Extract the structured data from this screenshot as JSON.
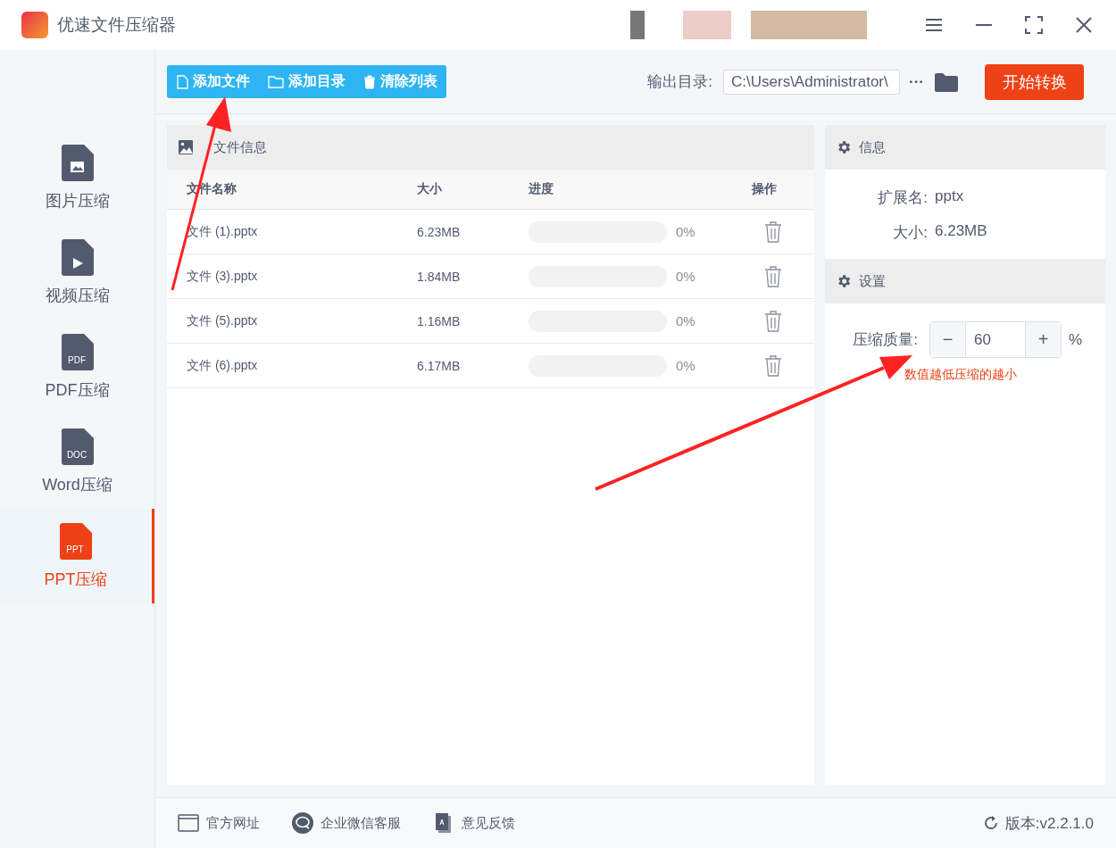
{
  "window": {
    "title": "优速文件压缩器"
  },
  "sidebar": {
    "items": [
      {
        "label": "图片压缩",
        "kind": "image",
        "selected": false
      },
      {
        "label": "视频压缩",
        "kind": "video",
        "selected": false
      },
      {
        "label": "PDF压缩",
        "kind": "text",
        "icon_text": "PDF",
        "selected": false
      },
      {
        "label": "Word压缩",
        "kind": "text",
        "icon_text": "DOC",
        "selected": false
      },
      {
        "label": "PPT压缩",
        "kind": "text",
        "icon_text": "PPT",
        "selected": true
      }
    ]
  },
  "toolbar": {
    "buttons": [
      {
        "label": "添加文件",
        "kind": "file"
      },
      {
        "label": "添加目录",
        "kind": "folder"
      },
      {
        "label": "清除列表",
        "kind": "trash"
      }
    ],
    "output_label": "输出目录:",
    "output_path": "C:\\Users\\Administrator\\",
    "more": "···",
    "start_button": "开始转换"
  },
  "file_panel": {
    "title": "文件信息",
    "columns": [
      "文件名称",
      "大小",
      "进度",
      "操作"
    ],
    "rows": [
      {
        "name": "文件 (1).pptx",
        "size": "6.23MB",
        "level": 0,
        "percent": "0%"
      },
      {
        "name": "文件 (3).pptx",
        "size": "1.84MB",
        "level": 0,
        "percent": "0%"
      },
      {
        "name": "文件 (5).pptx",
        "size": "1.16MB",
        "level": 0,
        "percent": "0%"
      },
      {
        "name": "文件 (6).pptx",
        "size": "6.17MB",
        "level": 0,
        "percent": "0%"
      }
    ]
  },
  "info_panel": {
    "title": "信息",
    "fields": [
      {
        "label": "扩展名:",
        "value": "pptx"
      },
      {
        "label": "大小:",
        "value": "6.23MB"
      }
    ]
  },
  "settings_panel": {
    "title": "设置",
    "quality_label": "压缩质量:",
    "minus": "−",
    "value": "60",
    "plus": "+",
    "unit": "%",
    "hint": "数值越低压缩的越小"
  },
  "footer": {
    "links": [
      {
        "label": "官方网址",
        "kind": "web"
      },
      {
        "label": "企业微信客服",
        "kind": "chat"
      },
      {
        "label": "意见反馈",
        "kind": "feedback"
      }
    ],
    "version": "版本:v2.2.1.0"
  }
}
